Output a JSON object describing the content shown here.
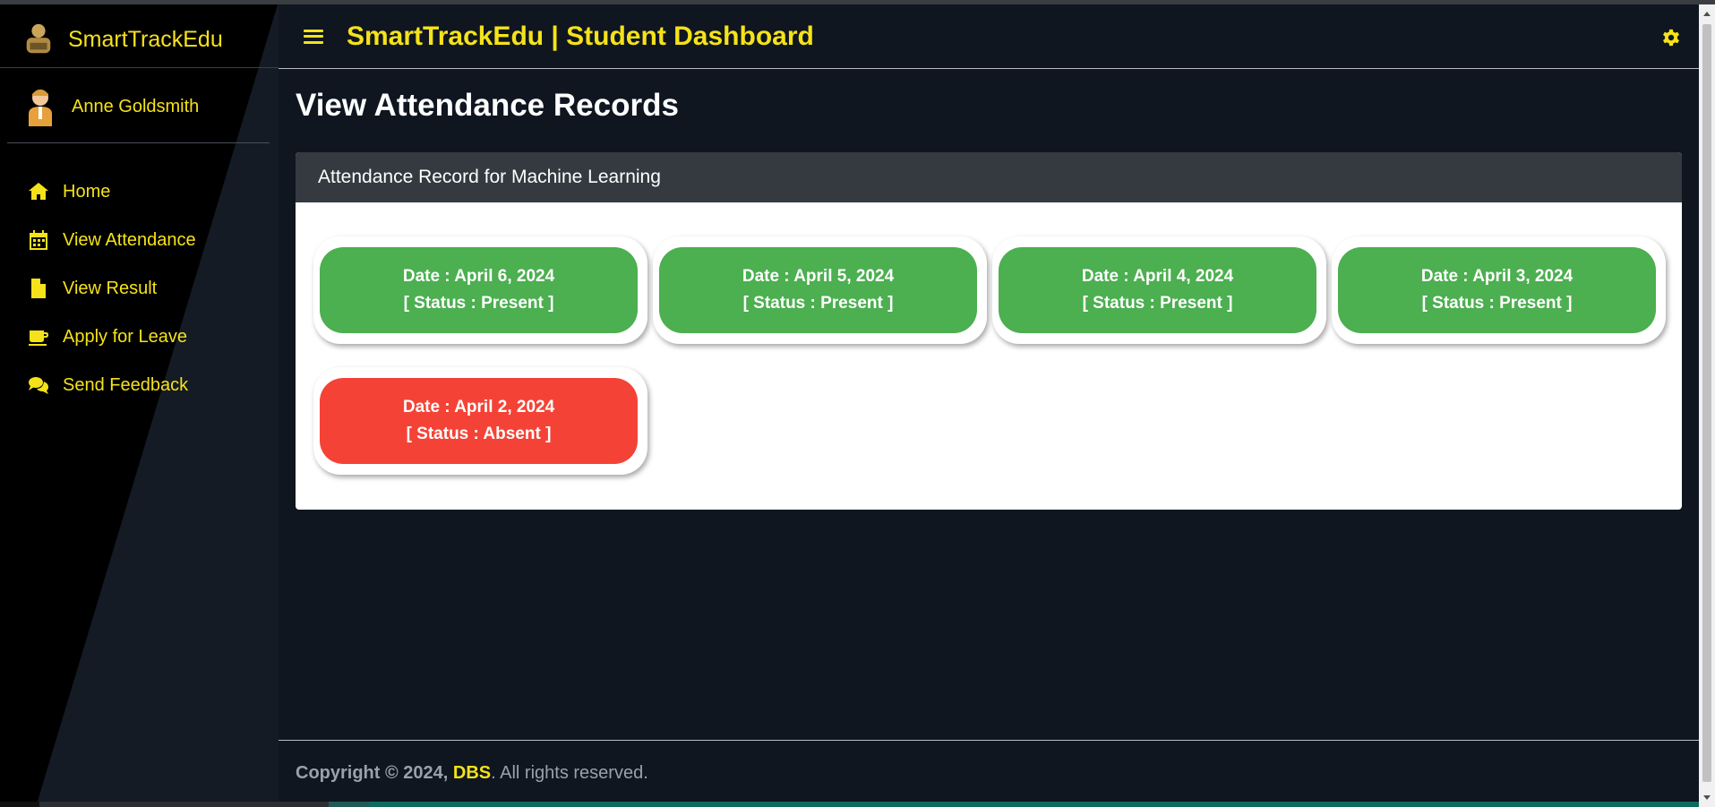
{
  "sidebar": {
    "brand": "SmartTrackEdu",
    "user_name": "Anne Goldsmith",
    "items": [
      {
        "label": "Home",
        "icon": "home-icon"
      },
      {
        "label": "View Attendance",
        "icon": "calendar-icon"
      },
      {
        "label": "View Result",
        "icon": "file-icon"
      },
      {
        "label": "Apply for Leave",
        "icon": "mug-icon"
      },
      {
        "label": "Send Feedback",
        "icon": "comments-icon"
      }
    ]
  },
  "header": {
    "title": "SmartTrackEdu | Student Dashboard",
    "menu_icon": "hamburger-icon",
    "settings_icon": "gear-icon"
  },
  "main": {
    "page_title": "View Attendance Records",
    "card_title": "Attendance Record for Machine Learning",
    "records": [
      {
        "date": "Date : April 6, 2024",
        "status": "[ Status : Present ]",
        "state": "present"
      },
      {
        "date": "Date : April 5, 2024",
        "status": "[ Status : Present ]",
        "state": "present"
      },
      {
        "date": "Date : April 4, 2024",
        "status": "[ Status : Present ]",
        "state": "present"
      },
      {
        "date": "Date : April 3, 2024",
        "status": "[ Status : Present ]",
        "state": "present"
      },
      {
        "date": "Date : April 2, 2024",
        "status": "[ Status : Absent ]",
        "state": "absent"
      }
    ]
  },
  "footer": {
    "copyright": "Copyright © 2024,",
    "org": "DBS",
    "rights": ". All rights reserved."
  },
  "colors": {
    "accent": "#f5e21a",
    "present": "#4caf50",
    "absent": "#f44336",
    "background": "#0f1620"
  }
}
